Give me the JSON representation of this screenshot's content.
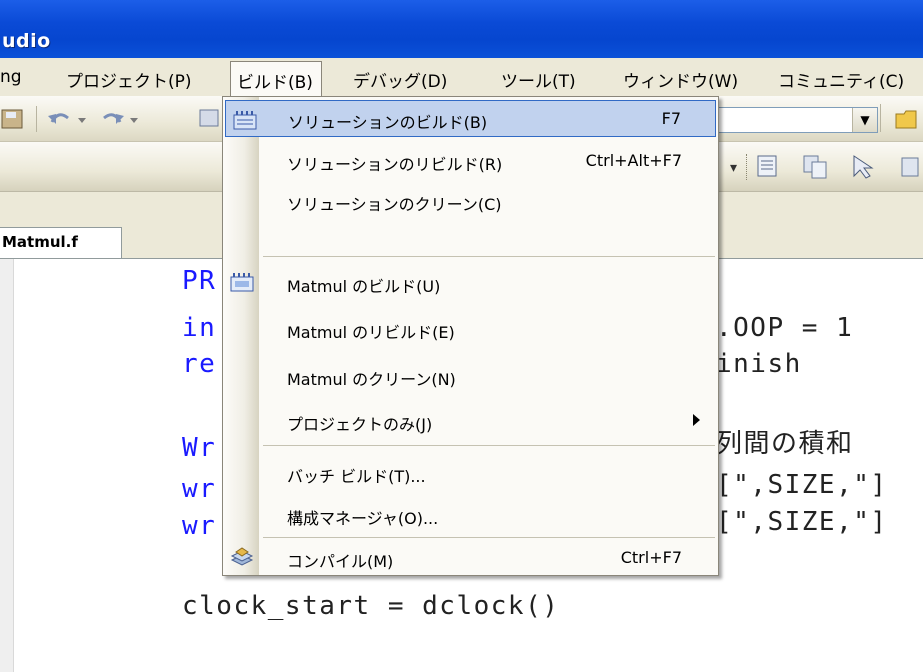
{
  "window": {
    "title": "udio"
  },
  "menubar": {
    "items": [
      {
        "label": "ng"
      },
      {
        "label": "プロジェクト(P)"
      },
      {
        "label": "ビルド(B)"
      },
      {
        "label": "デバッグ(D)"
      },
      {
        "label": "ツール(T)"
      },
      {
        "label": "ウィンドウ(W)"
      },
      {
        "label": "コミュニティ(C)"
      }
    ]
  },
  "editor": {
    "tab_label": "Matmul.f",
    "code_lines": [
      {
        "left": "PR",
        "right": ""
      },
      {
        "left": "in",
        "right": ".OOP = 1"
      },
      {
        "left": "re",
        "right": "inish"
      },
      {
        "left": "",
        "right": ""
      },
      {
        "left": "Wr",
        "right": "列間の積和"
      },
      {
        "left": "wr",
        "right": "[\",SIZE,\"]"
      },
      {
        "left": "wr",
        "right": "[\",SIZE,\"]"
      },
      {
        "left": "",
        "right": ""
      },
      {
        "left": "clock_start = dclock()",
        "right": ""
      }
    ]
  },
  "build_menu": {
    "items": [
      {
        "label": "ソリューションのビルド(B)",
        "shortcut": "F7",
        "icon": "build-solution-icon",
        "highlighted": true
      },
      {
        "label": "ソリューションのリビルド(R)",
        "shortcut": "Ctrl+Alt+F7"
      },
      {
        "label": "ソリューションのクリーン(C)",
        "shortcut": ""
      },
      {
        "label": "Matmul のビルド(U)",
        "shortcut": "",
        "icon": "build-project-icon"
      },
      {
        "label": "Matmul のリビルド(E)",
        "shortcut": ""
      },
      {
        "label": "Matmul のクリーン(N)",
        "shortcut": ""
      },
      {
        "label": "プロジェクトのみ(J)",
        "shortcut": "",
        "submenu": true
      },
      {
        "label": "バッチ ビルド(T)...",
        "shortcut": ""
      },
      {
        "label": "構成マネージャ(O)...",
        "shortcut": ""
      },
      {
        "label": "コンパイル(M)",
        "shortcut": "Ctrl+F7",
        "icon": "compile-icon"
      }
    ]
  },
  "colors": {
    "titlebar": "#0a4ad6",
    "menu_highlight": "#c1d2ee",
    "menu_highlight_border": "#316ac5",
    "code_blue": "#1a1aff"
  }
}
